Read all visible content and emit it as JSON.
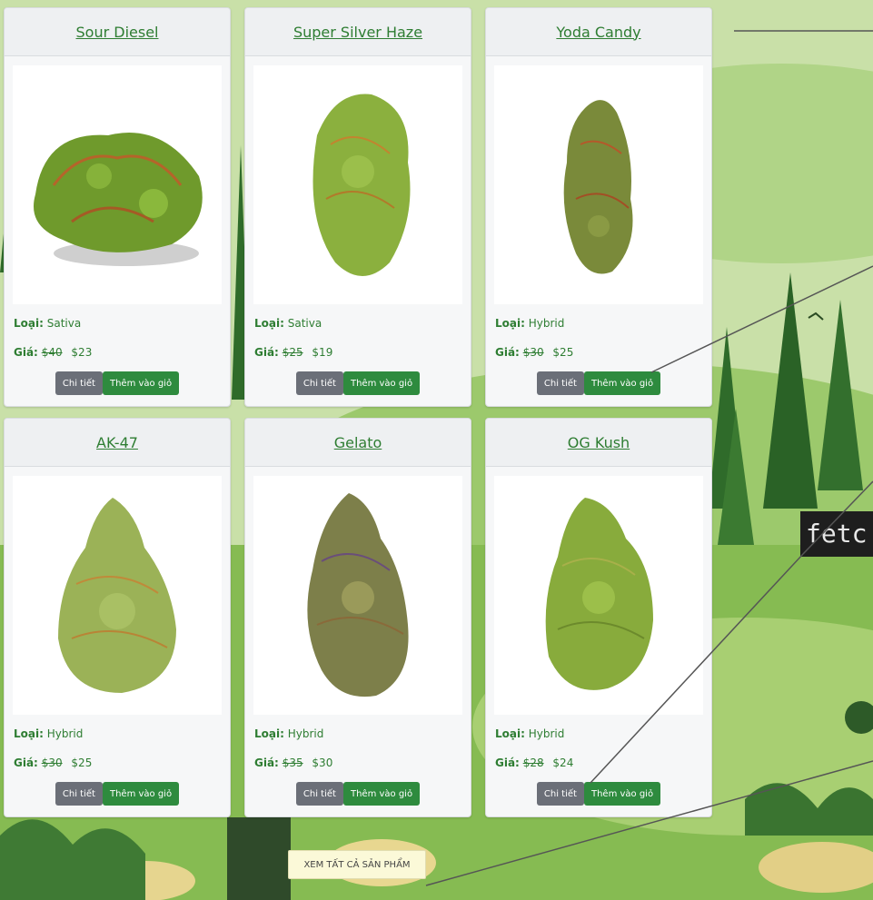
{
  "products": [
    {
      "name": "Sour Diesel",
      "type_label": "Loại:",
      "type": "Sativa",
      "price_label": "Giá:",
      "old_price": "$40",
      "price": "$23",
      "detail_label": "Chi tiết",
      "cart_label": "Thêm vào giỏ"
    },
    {
      "name": "Super Silver Haze",
      "type_label": "Loại:",
      "type": "Sativa",
      "price_label": "Giá:",
      "old_price": "$25",
      "price": "$19",
      "detail_label": "Chi tiết",
      "cart_label": "Thêm vào giỏ"
    },
    {
      "name": "Yoda Candy",
      "type_label": "Loại:",
      "type": "Hybrid",
      "price_label": "Giá:",
      "old_price": "$30",
      "price": "$25",
      "detail_label": "Chi tiết",
      "cart_label": "Thêm vào giỏ"
    },
    {
      "name": "AK-47",
      "type_label": "Loại:",
      "type": "Hybrid",
      "price_label": "Giá:",
      "old_price": "$30",
      "price": "$25",
      "detail_label": "Chi tiết",
      "cart_label": "Thêm vào giỏ"
    },
    {
      "name": "Gelato",
      "type_label": "Loại:",
      "type": "Hybrid",
      "price_label": "Giá:",
      "old_price": "$35",
      "price": "$30",
      "detail_label": "Chi tiết",
      "cart_label": "Thêm vào giỏ"
    },
    {
      "name": "OG Kush",
      "type_label": "Loại:",
      "type": "Hybrid",
      "price_label": "Giá:",
      "old_price": "$28",
      "price": "$24",
      "detail_label": "Chi tiết",
      "cart_label": "Thêm vào giỏ"
    }
  ],
  "view_all_label": "XEM TẤT CẢ SẢN PHẨM",
  "code_snippet": "fetc",
  "colors": {
    "accent_green": "#2e8b3e",
    "title_green": "#2e7d32",
    "detail_gray": "#6b6f78"
  }
}
